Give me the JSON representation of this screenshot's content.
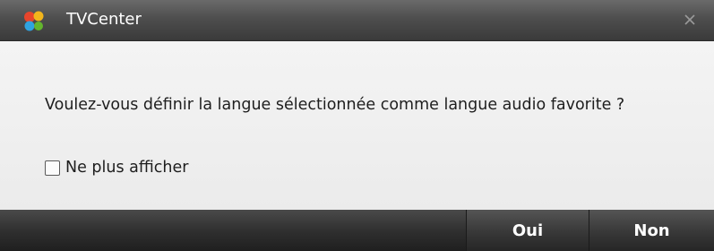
{
  "window": {
    "title": "TVCenter",
    "app_icon": "tvcenter-logo-icon",
    "close_icon": "close-icon"
  },
  "dialog": {
    "message": "Voulez-vous définir la langue sélectionnée comme langue audio favorite ?",
    "checkbox": {
      "label": "Ne plus afficher",
      "checked": false
    }
  },
  "buttons": {
    "yes_label": "Oui",
    "no_label": "Non"
  },
  "colors": {
    "titlebar": "#4e4e4e",
    "body": "#ececec",
    "footer": "#303030",
    "text": "#1e1e1e",
    "button_text": "#ffffff"
  }
}
